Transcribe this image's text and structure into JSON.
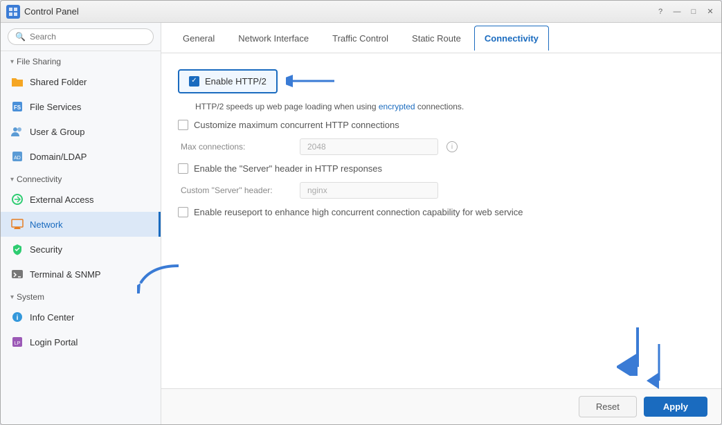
{
  "window": {
    "title": "Control Panel",
    "controls": [
      "?",
      "—",
      "□",
      "✕"
    ]
  },
  "sidebar": {
    "search_placeholder": "Search",
    "sections": [
      {
        "name": "File Sharing",
        "expanded": true,
        "items": [
          {
            "id": "shared-folder",
            "label": "Shared Folder",
            "icon": "folder"
          },
          {
            "id": "file-services",
            "label": "File Services",
            "icon": "file-services"
          },
          {
            "id": "user-group",
            "label": "User & Group",
            "icon": "user-group"
          },
          {
            "id": "domain-ldap",
            "label": "Domain/LDAP",
            "icon": "domain"
          }
        ]
      },
      {
        "name": "Connectivity",
        "expanded": true,
        "items": [
          {
            "id": "external-access",
            "label": "External Access",
            "icon": "external"
          },
          {
            "id": "network",
            "label": "Network",
            "icon": "network",
            "active": true
          },
          {
            "id": "security",
            "label": "Security",
            "icon": "security"
          },
          {
            "id": "terminal-snmp",
            "label": "Terminal & SNMP",
            "icon": "terminal"
          }
        ]
      },
      {
        "name": "System",
        "expanded": true,
        "items": [
          {
            "id": "info-center",
            "label": "Info Center",
            "icon": "info"
          },
          {
            "id": "login-portal",
            "label": "Login Portal",
            "icon": "login"
          }
        ]
      }
    ]
  },
  "tabs": [
    {
      "id": "general",
      "label": "General"
    },
    {
      "id": "network-interface",
      "label": "Network Interface"
    },
    {
      "id": "traffic-control",
      "label": "Traffic Control"
    },
    {
      "id": "static-route",
      "label": "Static Route"
    },
    {
      "id": "connectivity",
      "label": "Connectivity",
      "active": true
    }
  ],
  "content": {
    "enable_http2": {
      "label": "Enable HTTP/2",
      "checked": true,
      "description": "HTTP/2 speeds up web page loading when using encrypted connections."
    },
    "customize_connections": {
      "label": "Customize maximum concurrent HTTP connections",
      "checked": false
    },
    "max_connections": {
      "label": "Max connections:",
      "value": "2048"
    },
    "server_header": {
      "label": "Enable the \"Server\" header in HTTP responses",
      "checked": false
    },
    "custom_server_header": {
      "label": "Custom \"Server\" header:",
      "value": "nginx"
    },
    "reuseport": {
      "label": "Enable reuseport to enhance high concurrent connection capability for web service",
      "checked": false
    }
  },
  "footer": {
    "reset_label": "Reset",
    "apply_label": "Apply"
  }
}
